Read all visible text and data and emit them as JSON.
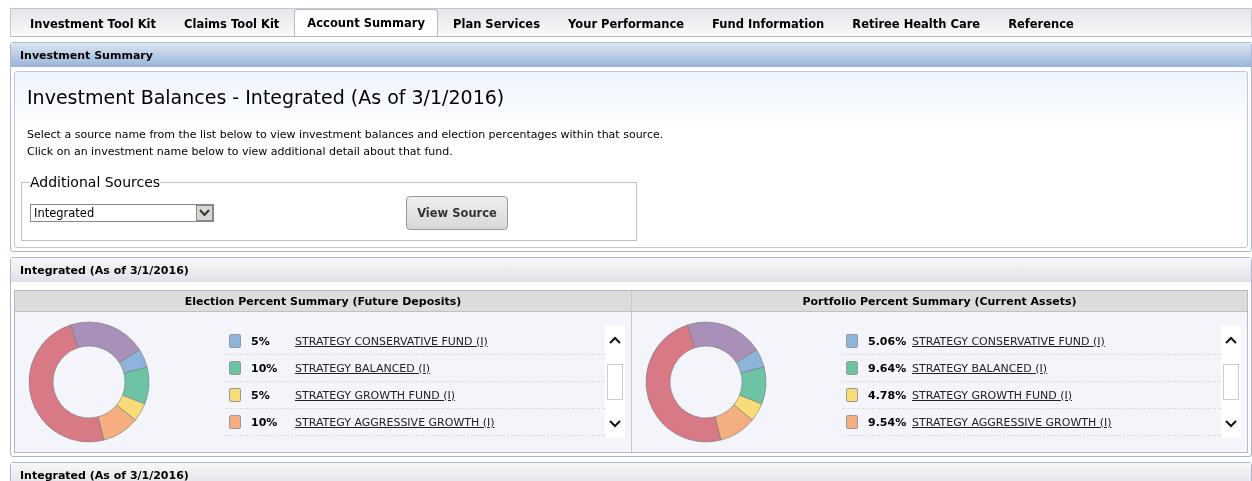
{
  "tabs": [
    {
      "label": "Investment Tool Kit",
      "selected": false
    },
    {
      "label": "Claims Tool Kit",
      "selected": false
    },
    {
      "label": "Account Summary",
      "selected": true
    },
    {
      "label": "Plan Services",
      "selected": false
    },
    {
      "label": "Your Performance",
      "selected": false
    },
    {
      "label": "Fund Information",
      "selected": false
    },
    {
      "label": "Retiree Health Care",
      "selected": false
    },
    {
      "label": "Reference",
      "selected": false
    }
  ],
  "summary_panel": {
    "header": "Investment Summary",
    "title": "Investment Balances - Integrated (As of 3/1/2016)",
    "instructions": [
      "Select a source name from the list below to view investment balances and election percentages within that source.",
      "Click on an investment name below to view additional detail about that fund."
    ],
    "sources": {
      "legend": "Additional Sources",
      "select_value": "Integrated",
      "button": "View Source"
    }
  },
  "integrated_panel": {
    "header": "Integrated (As of 3/1/2016)",
    "summaries": [
      {
        "title": "Election Percent Summary (Future Deposits)",
        "funds": [
          {
            "percent": "5%",
            "name": "STRATEGY CONSERVATIVE FUND (I)",
            "color": "#8fb4dc"
          },
          {
            "percent": "10%",
            "name": "STRATEGY BALANCED (I)",
            "color": "#6cc4a4"
          },
          {
            "percent": "5%",
            "name": "STRATEGY GROWTH FUND (I)",
            "color": "#f8dc78"
          },
          {
            "percent": "10%",
            "name": "STRATEGY AGGRESSIVE GROWTH (I)",
            "color": "#f4ae80"
          }
        ]
      },
      {
        "title": "Portfolio Percent Summary (Current Assets)",
        "funds": [
          {
            "percent": "5.06%",
            "name": "STRATEGY CONSERVATIVE FUND (I)",
            "color": "#8fb4dc"
          },
          {
            "percent": "9.64%",
            "name": "STRATEGY BALANCED (I)",
            "color": "#6cc4a4"
          },
          {
            "percent": "4.78%",
            "name": "STRATEGY GROWTH FUND (I)",
            "color": "#f8dc78"
          },
          {
            "percent": "9.54%",
            "name": "STRATEGY AGGRESSIVE GROWTH (I)",
            "color": "#f4ae80"
          }
        ]
      }
    ]
  },
  "next_panel": {
    "header": "Integrated (As of 3/1/2016)"
  }
}
